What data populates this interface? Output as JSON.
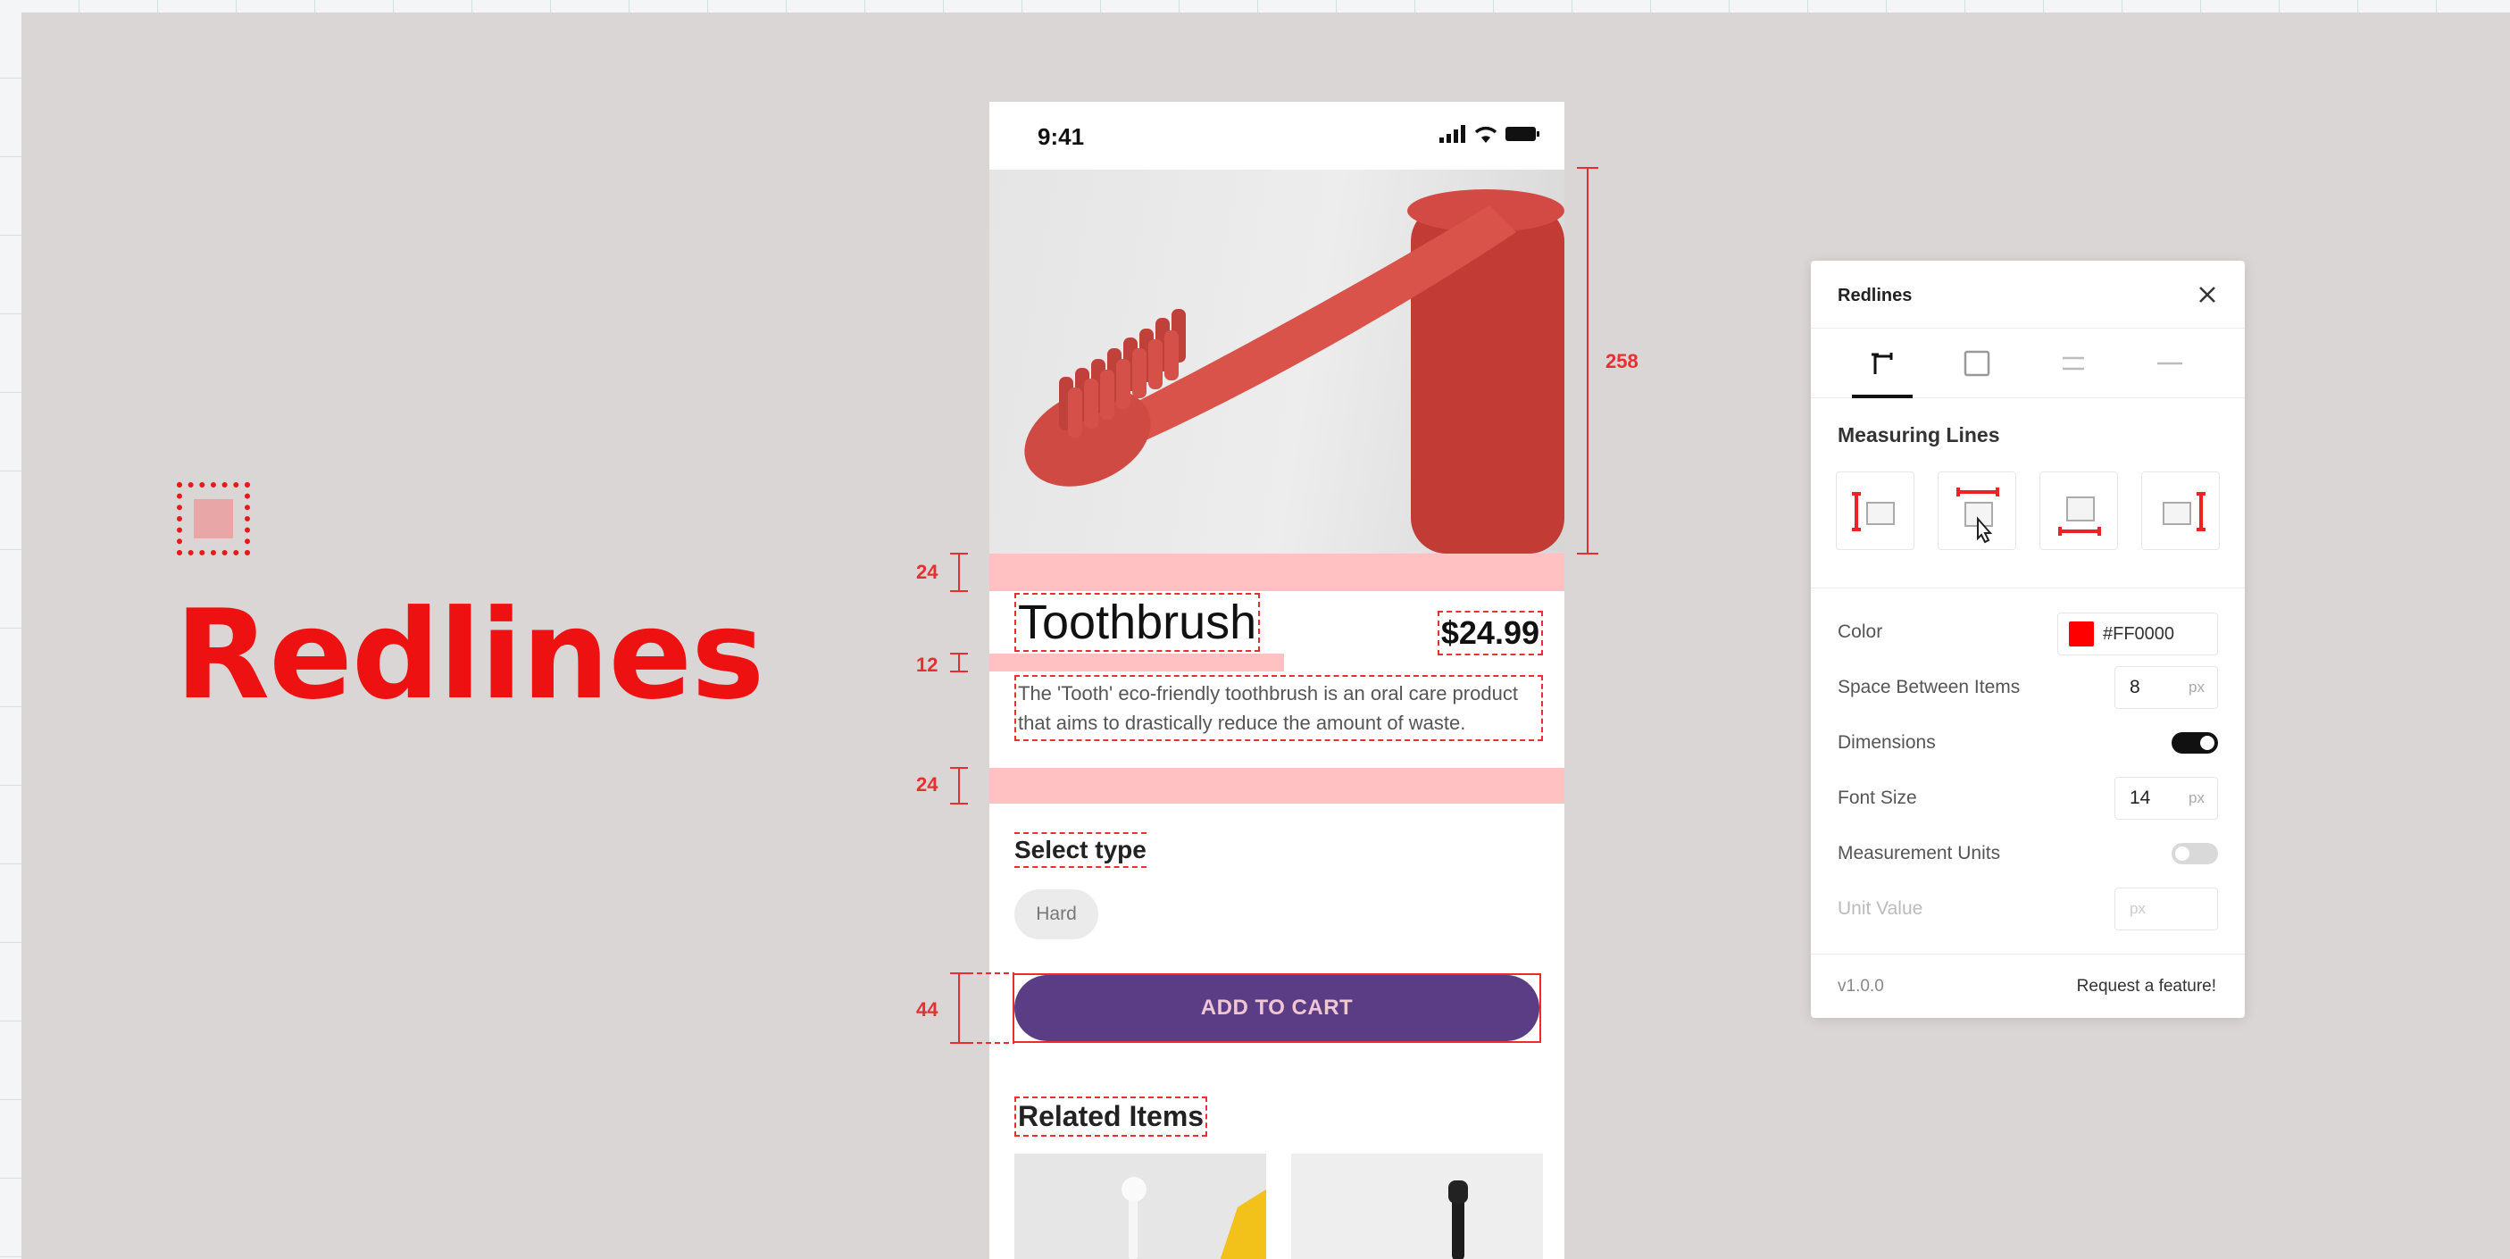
{
  "title": {
    "text": "Redlines"
  },
  "phone": {
    "status_time": "9:41",
    "product_name": "Toothbrush",
    "price": "$24.99",
    "description": "The 'Tooth' eco-friendly toothbrush is an oral care product that aims to drastically reduce the amount of waste.",
    "select_type_label": "Select type",
    "type_option": "Hard",
    "cart_button": "ADD TO CART",
    "related_title": "Related Items",
    "accent_color": "#5b3d85"
  },
  "annotations": {
    "image_height": "258",
    "gap_title": "24",
    "gap_desc": "12",
    "gap_after_desc": "24",
    "button_height": "44",
    "color": "#e63030"
  },
  "panel": {
    "title": "Redlines",
    "tabs": [
      {
        "icon": "measure-lines-icon",
        "active": true
      },
      {
        "icon": "square-outline-icon",
        "active": false
      },
      {
        "icon": "spacing-lines-icon",
        "active": false
      },
      {
        "icon": "line-icon",
        "active": false
      }
    ],
    "section_title": "Measuring Lines",
    "measure_buttons": [
      "measure-left-icon",
      "measure-top-icon",
      "measure-bottom-icon",
      "measure-right-icon"
    ],
    "color_label": "Color",
    "color_value": "#FF0000",
    "spacing_label": "Space Between Items",
    "spacing_value": "8",
    "spacing_unit": "px",
    "dimensions_label": "Dimensions",
    "dimensions_on": true,
    "font_size_label": "Font Size",
    "font_size_value": "14",
    "font_size_unit": "px",
    "units_label": "Measurement Units",
    "units_on": false,
    "unit_value_label": "Unit Value",
    "unit_value_placeholder": "px",
    "version": "v1.0.0",
    "feature_link": "Request a feature!"
  }
}
